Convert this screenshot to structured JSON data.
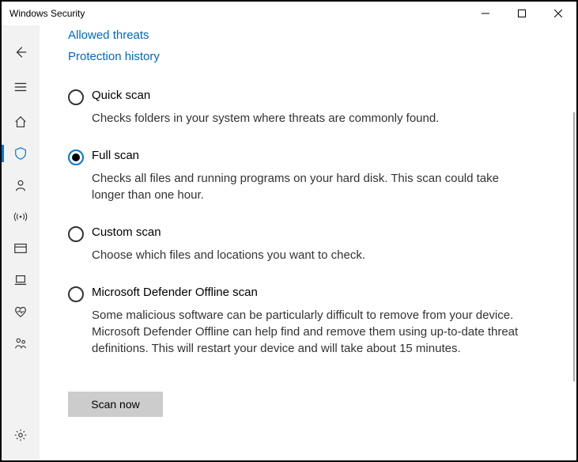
{
  "window": {
    "title": "Windows Security"
  },
  "links": {
    "allowed": "Allowed threats",
    "history": "Protection history"
  },
  "options": {
    "quick": {
      "title": "Quick scan",
      "desc": "Checks folders in your system where threats are commonly found."
    },
    "full": {
      "title": "Full scan",
      "desc": "Checks all files and running programs on your hard disk. This scan could take longer than one hour."
    },
    "custom": {
      "title": "Custom scan",
      "desc": "Choose which files and locations you want to check."
    },
    "offline": {
      "title": "Microsoft Defender Offline scan",
      "desc": "Some malicious software can be particularly difficult to remove from your device. Microsoft Defender Offline can help find and remove them using up-to-date threat definitions. This will restart your device and will take about 15 minutes."
    }
  },
  "selected_option": "full",
  "button": {
    "scan_now": "Scan now"
  },
  "sidebar": {
    "icons": [
      "back",
      "menu",
      "home",
      "shield",
      "account",
      "signal",
      "firewall",
      "app",
      "health",
      "family",
      "settings"
    ],
    "selected": "shield"
  }
}
